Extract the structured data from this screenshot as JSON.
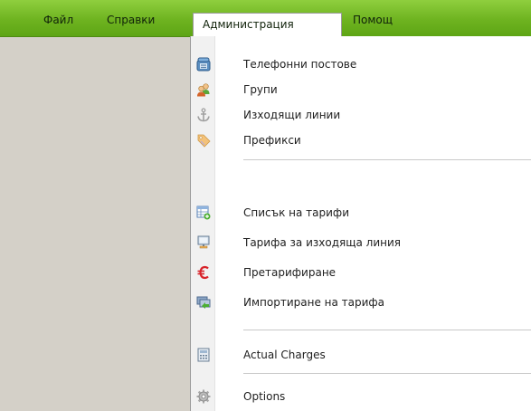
{
  "menubar": {
    "items": [
      {
        "label": "Файл"
      },
      {
        "label": "Справки"
      },
      {
        "label": "Администрация"
      },
      {
        "label": "Помощ"
      }
    ]
  },
  "menu": {
    "items": [
      {
        "label": "Телефонни постове",
        "icon": "telephone-icon"
      },
      {
        "label": "Групи",
        "icon": "group-users-icon"
      },
      {
        "label": "Изходящи линии",
        "icon": "anchor-icon"
      },
      {
        "label": "Префикси",
        "icon": "tag-icon"
      },
      {
        "label": "Списък на тарифи",
        "icon": "table-add-icon"
      },
      {
        "label": "Тарифа за изходяща линия",
        "icon": "monitor-icon"
      },
      {
        "label": "Претарифиране",
        "icon": "euro-icon"
      },
      {
        "label": "Импортиране на тарифа",
        "icon": "import-icon"
      },
      {
        "label": "Actual Charges",
        "icon": "calculator-icon"
      },
      {
        "label": "Options",
        "icon": "gear-icon"
      }
    ]
  },
  "colors": {
    "menubar": "#6eb320",
    "canvas": "#d4d0c8",
    "menu_bg": "#ffffff",
    "euro": "#d8232a"
  }
}
